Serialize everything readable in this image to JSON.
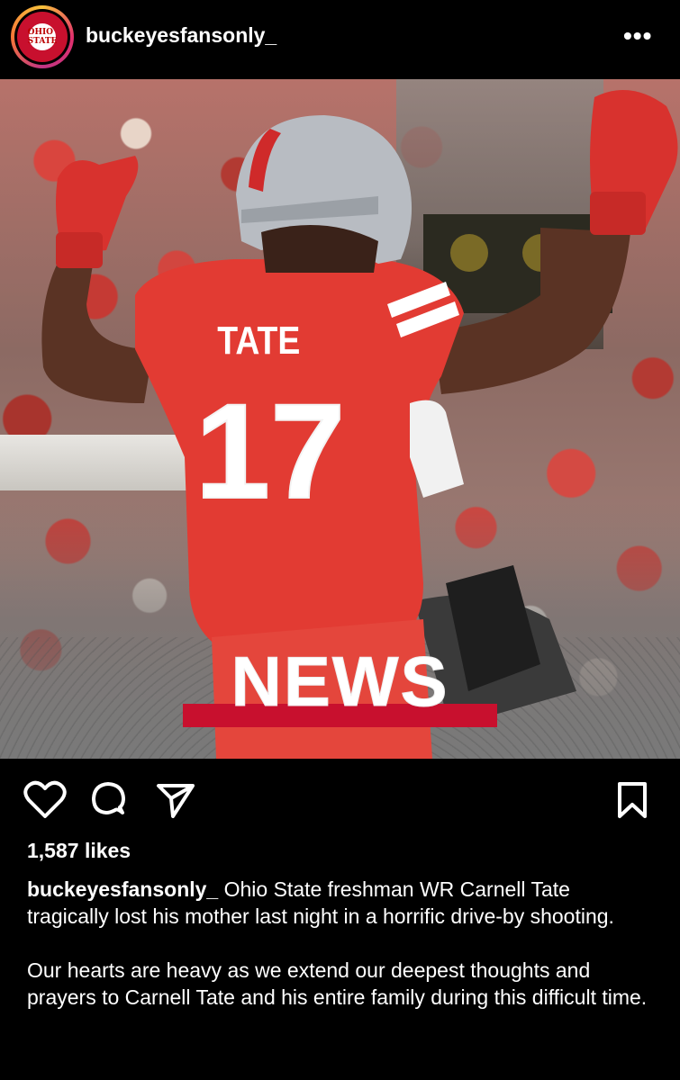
{
  "header": {
    "username": "buckeyesfansonly_",
    "avatar_text": "OHIO\nSTATE",
    "more_label": "•••"
  },
  "post_image": {
    "player_name": "TATE",
    "player_number": "17",
    "banner_text": "NEWS",
    "accent_color": "#c8102e"
  },
  "actions": {
    "icons": [
      "heart-icon",
      "comment-icon",
      "share-icon",
      "bookmark-icon"
    ]
  },
  "likes": "1,587 likes",
  "caption": {
    "username": "buckeyesfansonly_",
    "text": "Ohio State freshman WR Carnell Tate tragically lost his mother last night in a horrific drive-by shooting.",
    "paragraph2": "Our hearts are heavy as we extend our deepest thoughts and prayers to Carnell Tate and his entire family during this difficult time."
  }
}
